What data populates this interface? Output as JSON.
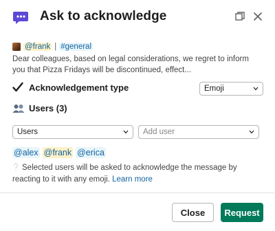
{
  "header": {
    "title": "Ask to acknowledge",
    "app_icon": "megaphone-chat-icon",
    "popout_icon": "popout-icon",
    "close_icon": "close-icon"
  },
  "message": {
    "author": "@frank",
    "separator": "|",
    "channel": "#general",
    "preview": "Dear colleagues, based on legal considerations, we regret to inform you that Pizza Fridays will be discontinued, effect..."
  },
  "acknowledgement": {
    "label": "Acknowledgement type",
    "icon": "checkmark-icon",
    "type_value": "Emoji"
  },
  "users": {
    "label": "Users (3)",
    "icon": "users-icon",
    "filter_value": "Users",
    "add_placeholder": "Add user",
    "selected": [
      "@alex",
      "@frank",
      "@erica"
    ]
  },
  "info": {
    "text": "Selected users will be asked to acknowledge the message by reacting to it with any emoji.",
    "link": "Learn more"
  },
  "footer": {
    "close_label": "Close",
    "request_label": "Request"
  },
  "colors": {
    "accent": "#007a5a",
    "link": "#1264a3",
    "app_icon": "#5b49d6"
  }
}
